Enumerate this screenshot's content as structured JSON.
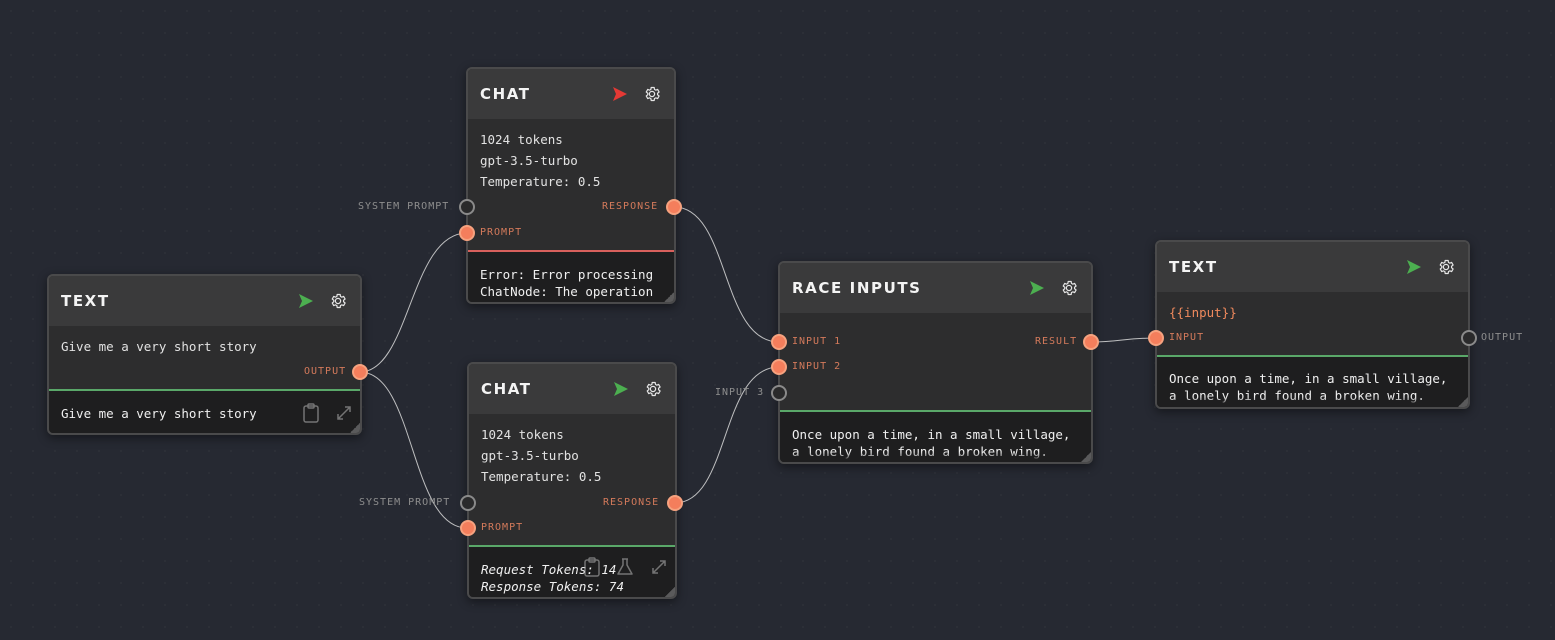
{
  "colors": {
    "canvas": "#262932",
    "wire": "#d9d9d9",
    "port_active": "#f47e5c",
    "success": "#5aa869",
    "error": "#d8605c",
    "run_ok": "#4caf50",
    "run_error": "#e53935"
  },
  "icons": {
    "run": "play-triangle-icon",
    "settings": "gear-icon",
    "copy": "clipboard-icon",
    "expand": "expand-arrows-icon",
    "test": "flask-icon"
  },
  "nodes": {
    "text_input": {
      "title": "TEXT",
      "body": "Give me a very short story",
      "output_port": "OUTPUT",
      "result": "Give me a very short story",
      "status": "success"
    },
    "chat_1": {
      "title": "CHAT",
      "tokens": "1024 tokens",
      "model": "gpt-3.5-turbo",
      "temperature": "Temperature: 0.5",
      "input_ports": [
        "SYSTEM PROMPT",
        "PROMPT"
      ],
      "output_port": "RESPONSE",
      "result_line1": "Error: Error processing",
      "result_line2": "ChatNode: The operation",
      "status": "error"
    },
    "chat_2": {
      "title": "CHAT",
      "tokens": "1024 tokens",
      "model": "gpt-3.5-turbo",
      "temperature": "Temperature: 0.5",
      "input_ports": [
        "SYSTEM PROMPT",
        "PROMPT"
      ],
      "output_port": "RESPONSE",
      "request_tokens": "Request Tokens: 14",
      "response_tokens": "Response Tokens: 74",
      "status": "success"
    },
    "race": {
      "title": "RACE INPUTS",
      "input_ports": [
        "INPUT 1",
        "INPUT 2",
        "INPUT 3"
      ],
      "output_port": "RESULT",
      "result_line1": "Once upon a time, in a small village,",
      "result_line2": "a lonely bird found a broken wing.",
      "status": "success"
    },
    "text_output": {
      "title": "TEXT",
      "body": "{{input}}",
      "input_port": "INPUT",
      "output_port": "OUTPUT",
      "result_line1": "Once upon a time, in a small village,",
      "result_line2": "a lonely bird found a broken wing.",
      "status": "success"
    }
  }
}
